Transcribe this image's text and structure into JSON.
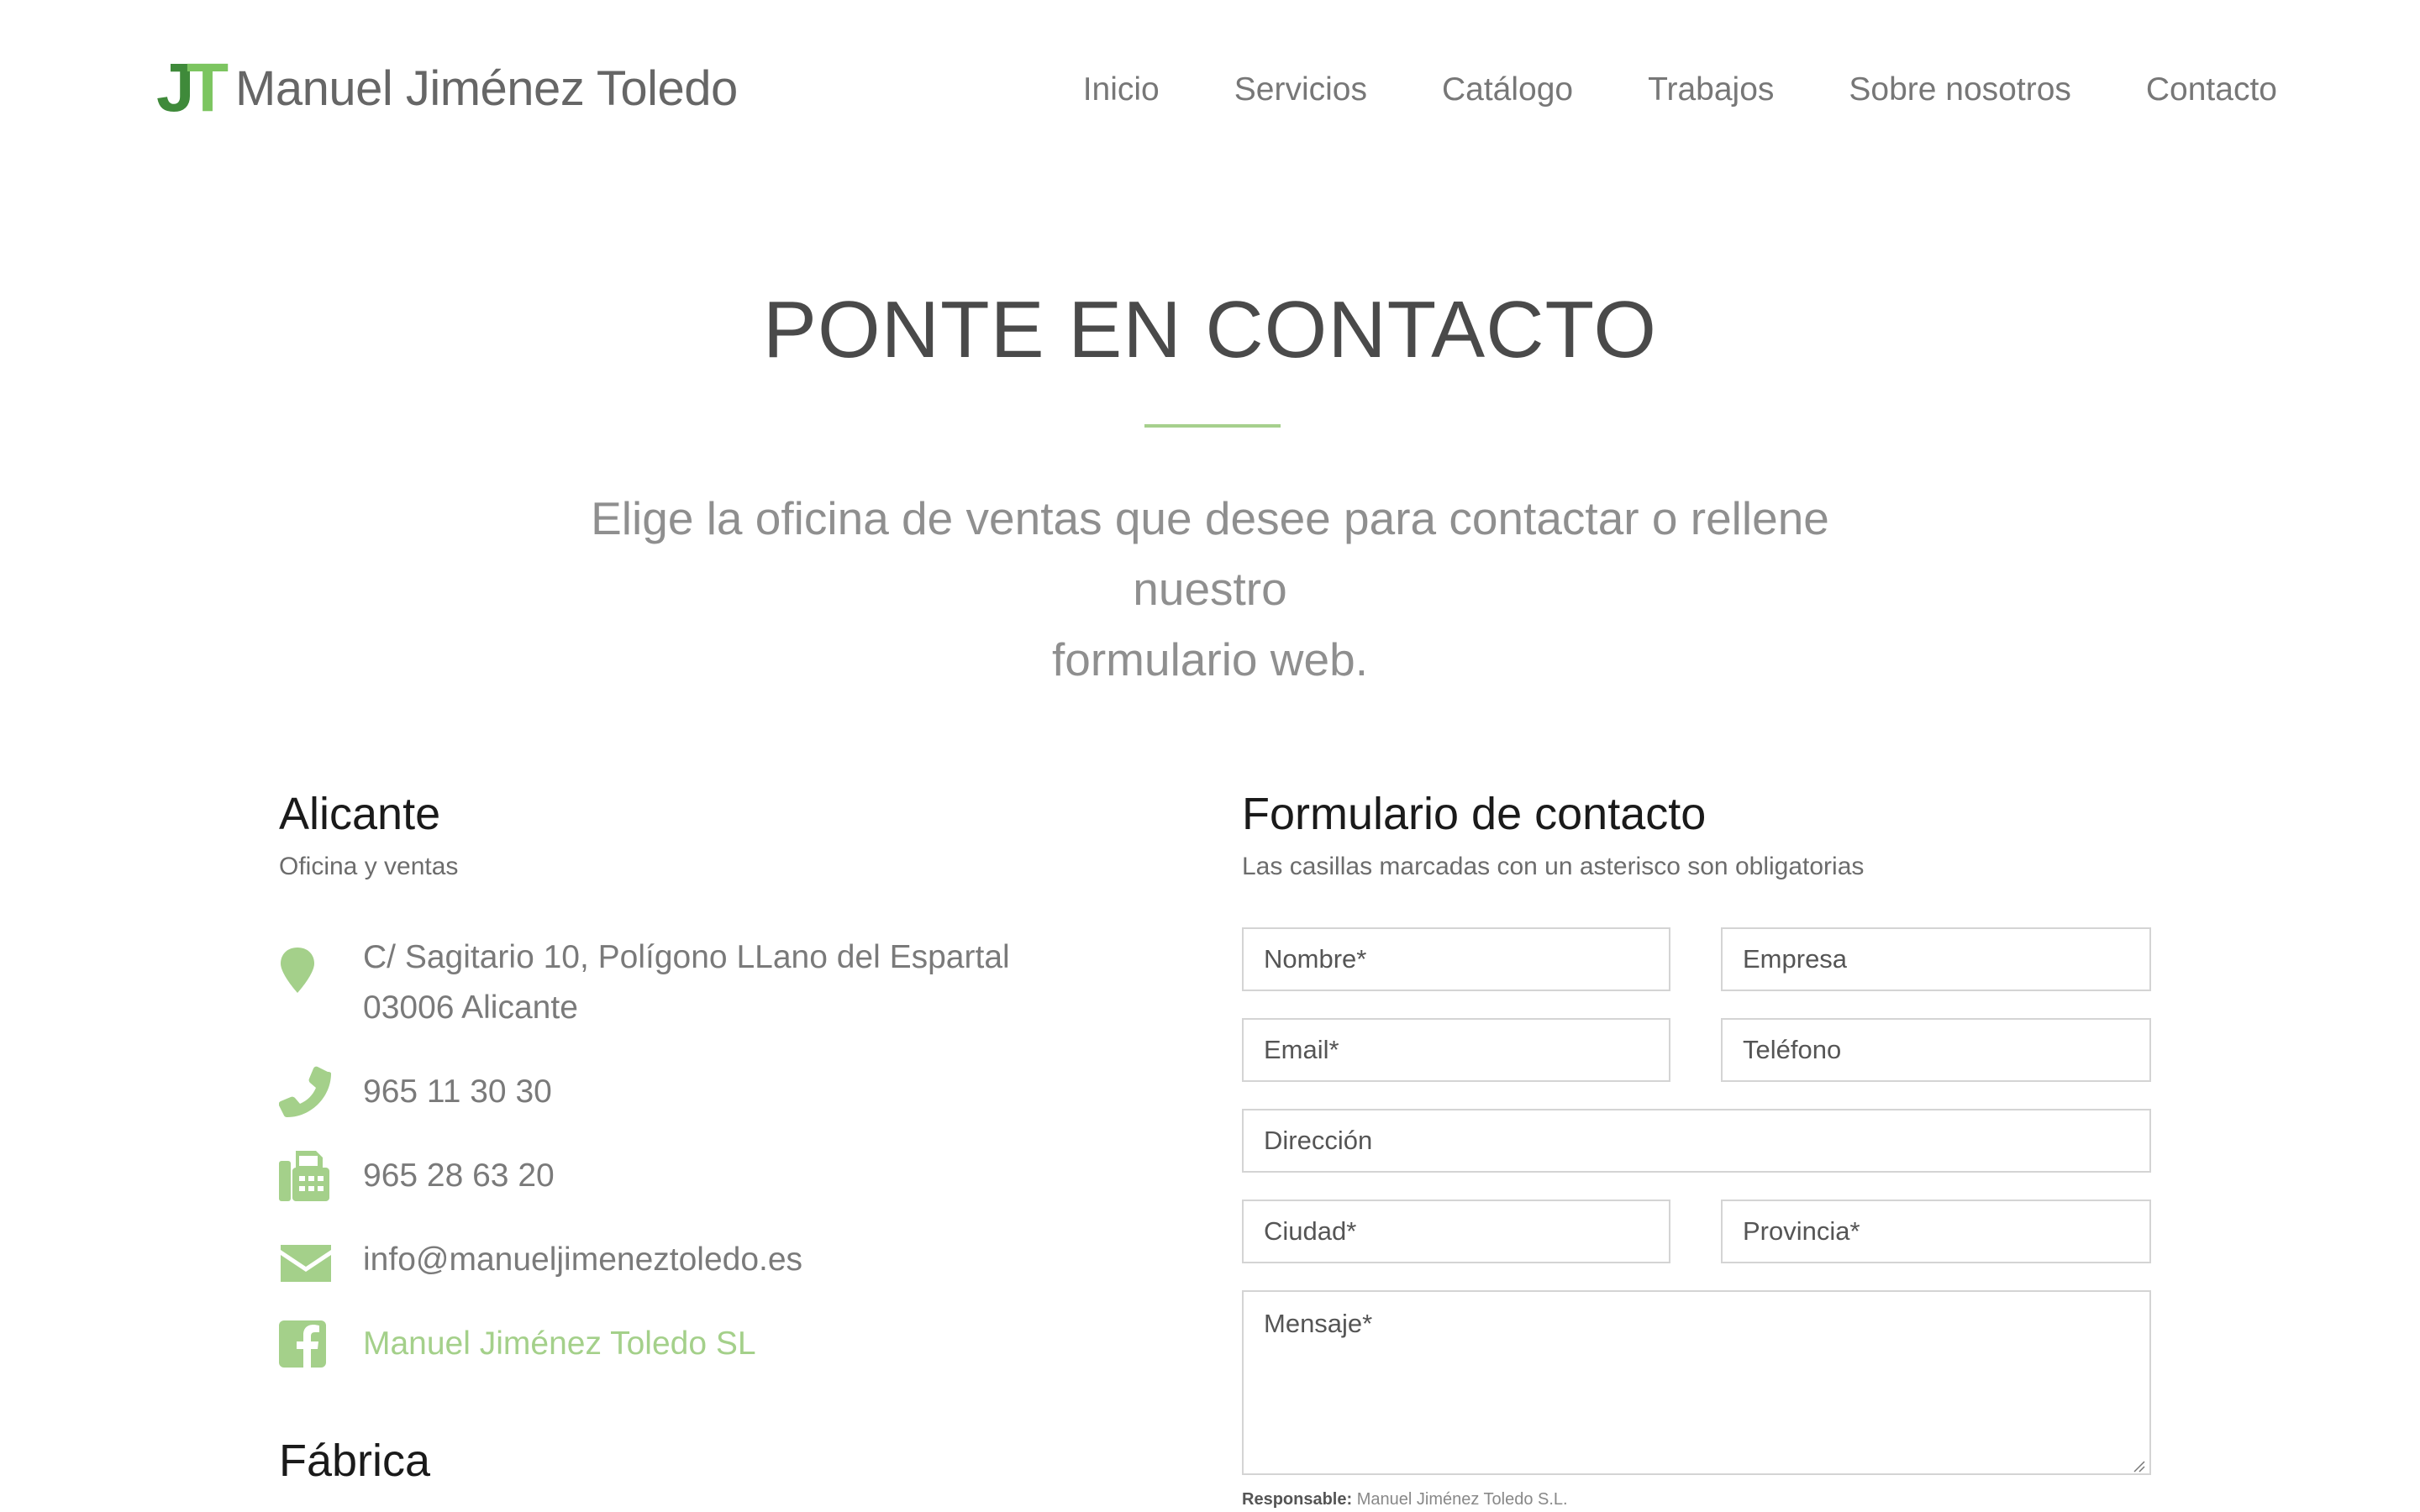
{
  "brand": {
    "mark_j": "J",
    "mark_t": "T",
    "name": "Manuel Jiménez Toledo",
    "color_j": "#3f8a3a",
    "color_t": "#7cc560"
  },
  "nav": {
    "items": [
      "Inicio",
      "Servicios",
      "Catálogo",
      "Trabajos",
      "Sobre nosotros",
      "Contacto"
    ]
  },
  "hero": {
    "title": "PONTE EN CONTACTO",
    "subtitle_line1": "Elige la oficina de ventas que desee para contactar o rellene nuestro",
    "subtitle_line2": "formulario web.",
    "accent_color": "#a6d08d"
  },
  "office": {
    "title": "Alicante",
    "subtitle": "Oficina y ventas",
    "address_line1": "C/ Sagitario 10, Polígono LLano del Espartal",
    "address_line2": "03006 Alicante",
    "phone": "965 11 30 30",
    "fax": "965 28 63 20",
    "email": "info@manueljimeneztoledo.es",
    "facebook": "Manuel Jiménez Toledo SL",
    "icons": [
      "map-pin-icon",
      "phone-icon",
      "fax-icon",
      "envelope-icon",
      "facebook-icon"
    ],
    "icon_color": "#a4d08a"
  },
  "factory": {
    "title": "Fábrica"
  },
  "form": {
    "title": "Formulario de contacto",
    "subtitle": "Las casillas marcadas con un asterisco son obligatorias",
    "placeholders": {
      "nombre": "Nombre*",
      "empresa": "Empresa",
      "email": "Email*",
      "telefono": "Teléfono",
      "direccion": "Dirección",
      "ciudad": "Ciudad*",
      "provincia": "Provincia*",
      "mensaje": "Mensaje*"
    },
    "legal_label": "Responsable:",
    "legal_value": "Manuel Jiménez Toledo S.L."
  }
}
